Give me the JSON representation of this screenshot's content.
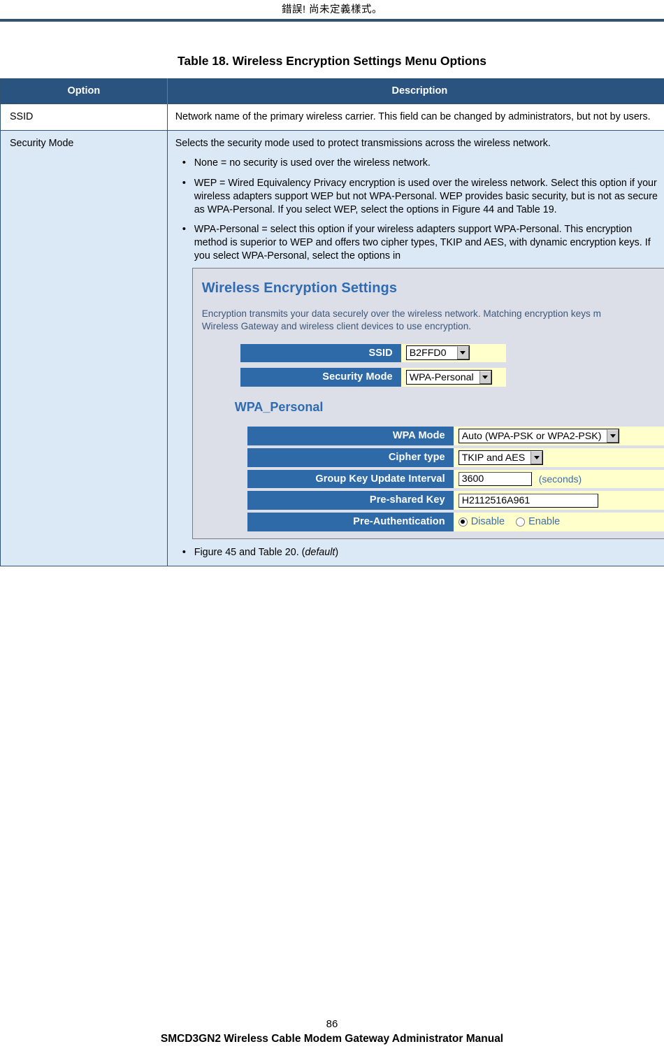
{
  "header": {
    "running_head": "錯誤! 尚未定義樣式。"
  },
  "table": {
    "caption": "Table 18. Wireless Encryption Settings Menu Options",
    "columns": [
      "Option",
      "Description"
    ],
    "rows": [
      {
        "option": "SSID",
        "description": "Network name of the primary wireless carrier. This field can be changed by administrators, but not by users."
      },
      {
        "option": "Security Mode",
        "description": "Selects the security mode used to protect transmissions across the wireless network.",
        "bullets": [
          "None = no security is used over the wireless network.",
          "WEP = Wired Equivalency Privacy encryption is used over the wireless network. Select this option if your wireless adapters support WEP but not WPA-Personal. WEP provides basic security, but is not as secure as WPA-Personal. If you select WEP, select the options in Figure 44 and Table 19.",
          "WPA-Personal = select this option if your wireless adapters support WPA-Personal. This encryption method is superior to WEP and offers two cipher types, TKIP and AES, with dynamic encryption keys. If you select WPA-Personal, select the options in"
        ],
        "final_bullet_prefix": "Figure 45 and Table 20. (",
        "final_bullet_italic": "default",
        "final_bullet_suffix": ")"
      }
    ]
  },
  "screenshot": {
    "title": "Wireless Encryption Settings",
    "intro_line1": "Encryption transmits your data securely over the wireless network. Matching encryption keys m",
    "intro_line2": "Wireless Gateway and wireless client devices to use encryption.",
    "section_title": "WPA_Personal",
    "fields_top": [
      {
        "label": "SSID",
        "value": "B2FFD0",
        "control": "select"
      },
      {
        "label": "Security Mode",
        "value": "WPA-Personal",
        "control": "select"
      }
    ],
    "fields_wpa": [
      {
        "label": "WPA Mode",
        "value": "Auto (WPA-PSK or WPA2-PSK)",
        "control": "select"
      },
      {
        "label": "Cipher type",
        "value": "TKIP and AES",
        "control": "select"
      },
      {
        "label": "Group Key Update Interval",
        "value": "3600",
        "control": "text",
        "units": "(seconds)"
      },
      {
        "label": "Pre-shared Key",
        "value": "H2112516A961",
        "control": "text"
      },
      {
        "label": "Pre-Authentication",
        "control": "radio",
        "options": [
          "Disable",
          "Enable"
        ],
        "selected": "Disable"
      }
    ]
  },
  "footer": {
    "page_number": "86",
    "document_title": "SMCD3GN2 Wireless Cable Modem Gateway Administrator Manual"
  }
}
